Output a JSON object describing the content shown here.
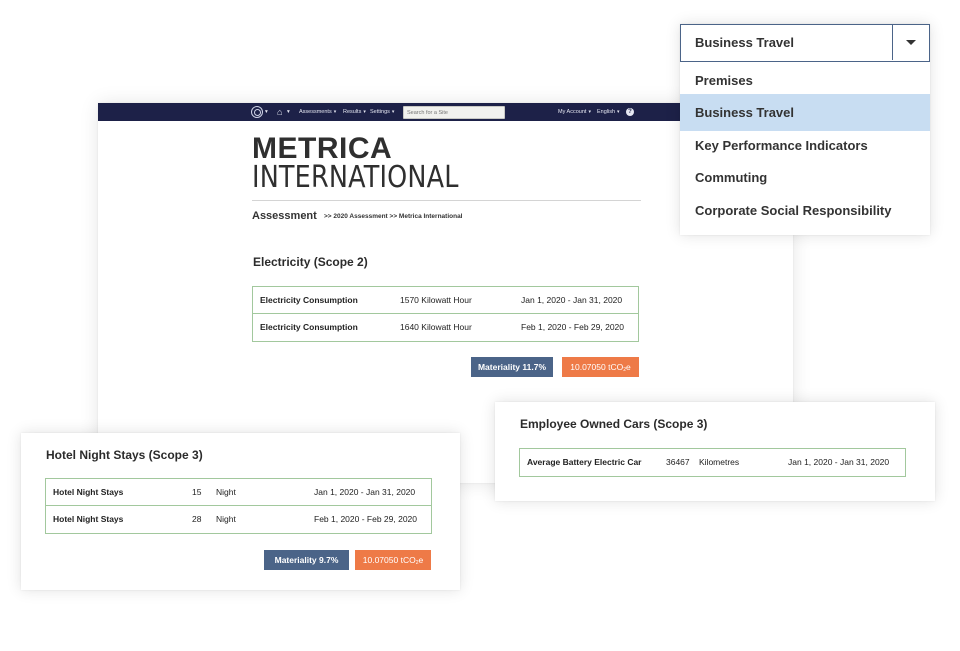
{
  "navbar": {
    "logo_icon": "globe-logo-icon",
    "home_icon": "home-icon",
    "menus": [
      "Assessments",
      "Results",
      "Settings"
    ],
    "search_placeholder": "Search for a Site",
    "account_label": "My Account",
    "language_label": "English",
    "help_icon": "help-icon",
    "help_glyph": "?",
    "caret_glyph": "▾"
  },
  "brand": {
    "line1": "METRICA",
    "line2": "INTERNATIONAL"
  },
  "header": {
    "title": "Assessment",
    "breadcrumb": ">> 2020 Assessment >> Metrica International"
  },
  "electricity": {
    "title": "Electricity (Scope 2)",
    "rows": [
      {
        "name": "Electricity Consumption",
        "quantity": "1570 Kilowatt Hour",
        "period": "Jan 1, 2020 - Jan 31, 2020"
      },
      {
        "name": "Electricity Consumption",
        "quantity": "1640 Kilowatt Hour",
        "period": "Feb 1, 2020 - Feb 29, 2020"
      }
    ],
    "materiality": "Materiality 11.7%",
    "emissions_value": "10.07050 tCO",
    "emissions_sub": "2",
    "emissions_suffix": "e"
  },
  "hotel": {
    "title": "Hotel Night Stays (Scope 3)",
    "rows": [
      {
        "name": "Hotel Night Stays",
        "amount": "15",
        "unit": "Night",
        "period": "Jan 1, 2020 - Jan 31, 2020"
      },
      {
        "name": "Hotel Night Stays",
        "amount": "28",
        "unit": "Night",
        "period": "Feb 1, 2020 - Feb 29, 2020"
      }
    ],
    "materiality": "Materiality 9.7%",
    "emissions_value": "10.07050 tCO",
    "emissions_sub": "2",
    "emissions_suffix": "e"
  },
  "cars": {
    "title": "Employee Owned Cars (Scope 3)",
    "rows": [
      {
        "name": "Average Battery Electric Car",
        "amount": "36467",
        "unit": "Kilometres",
        "period": "Jan 1, 2020 - Jan 31, 2020"
      }
    ]
  },
  "dropdown": {
    "selected": "Business Travel",
    "options": [
      "Premises",
      "Business Travel",
      "Key Performance Indicators",
      "Commuting",
      "Corporate Social Responsibility"
    ],
    "highlighted_index": 1
  },
  "colors": {
    "navbar": "#1d2148",
    "table_border": "#a2c89d",
    "materiality_badge": "#4b6488",
    "emissions_badge": "#ee7a47",
    "dropdown_highlight": "#c8ddf2"
  }
}
